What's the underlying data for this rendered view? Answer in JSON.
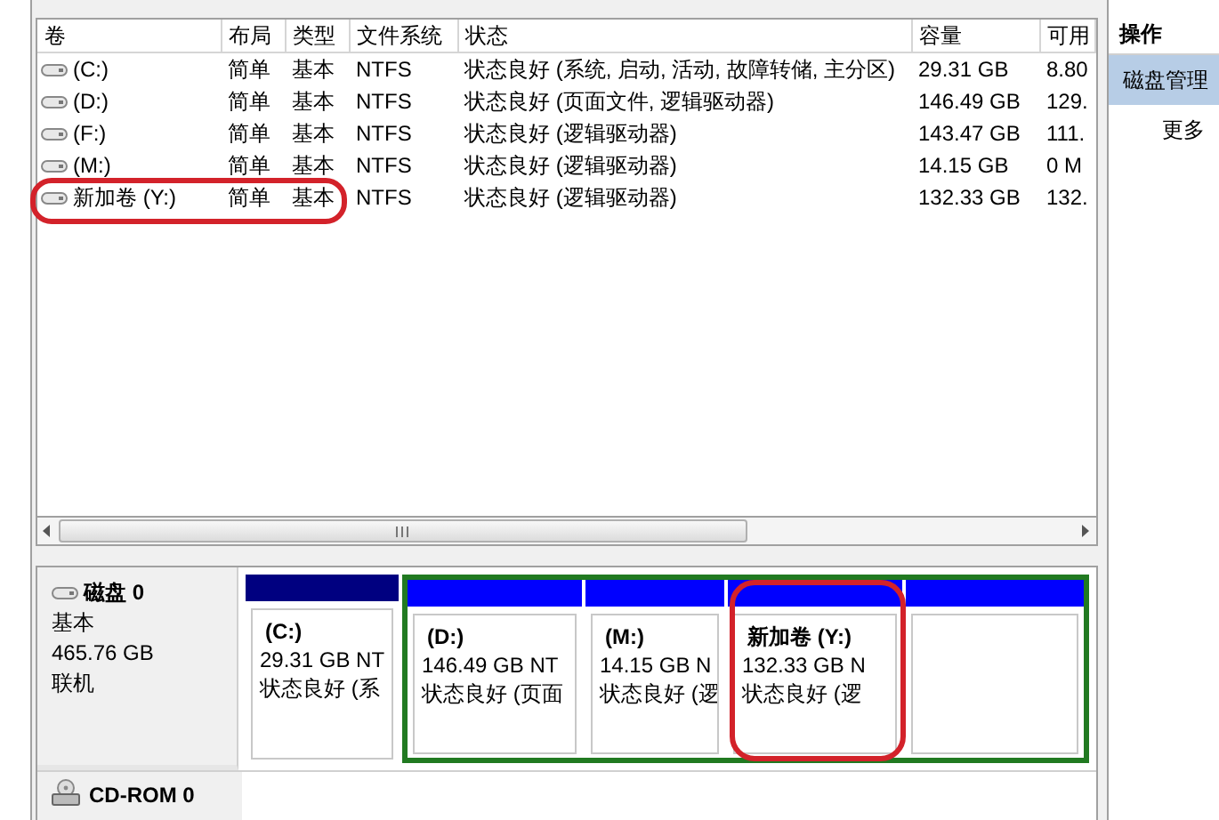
{
  "columns": [
    "卷",
    "布局",
    "类型",
    "文件系统",
    "状态",
    "容量",
    "可用"
  ],
  "volumes": [
    {
      "name": "(C:)",
      "layout": "简单",
      "type": "基本",
      "fs": "NTFS",
      "status": "状态良好 (系统, 启动, 活动, 故障转储, 主分区)",
      "capacity": "29.31 GB",
      "free": "8.80",
      "highlighted": false
    },
    {
      "name": "(D:)",
      "layout": "简单",
      "type": "基本",
      "fs": "NTFS",
      "status": "状态良好 (页面文件, 逻辑驱动器)",
      "capacity": "146.49 GB",
      "free": "129.",
      "highlighted": false
    },
    {
      "name": "(F:)",
      "layout": "简单",
      "type": "基本",
      "fs": "NTFS",
      "status": "状态良好 (逻辑驱动器)",
      "capacity": "143.47 GB",
      "free": "111.",
      "highlighted": false
    },
    {
      "name": "(M:)",
      "layout": "简单",
      "type": "基本",
      "fs": "NTFS",
      "status": "状态良好 (逻辑驱动器)",
      "capacity": "14.15 GB",
      "free": "0 M",
      "highlighted": false
    },
    {
      "name": "新加卷 (Y:)",
      "layout": "简单",
      "type": "基本",
      "fs": "NTFS",
      "status": "状态良好 (逻辑驱动器)",
      "capacity": "132.33 GB",
      "free": "132.",
      "highlighted": true
    }
  ],
  "disks": [
    {
      "kind": "disk",
      "name": "磁盘 0",
      "type": "基本",
      "size": "465.76 GB",
      "state": "联机",
      "partitions": [
        {
          "label": "(C:)",
          "size": "29.31 GB NT",
          "status": "状态良好 (系",
          "color": "#000080",
          "extended": false,
          "highlighted": false
        },
        {
          "label": "(D:)",
          "size": "146.49 GB NT",
          "status": "状态良好 (页面",
          "color": "#0000ff",
          "extended": true,
          "highlighted": false
        },
        {
          "label": "(M:)",
          "size": "14.15 GB N",
          "status": "状态良好 (逻",
          "color": "#0000ff",
          "extended": true,
          "highlighted": false
        },
        {
          "label": "新加卷  (Y:)",
          "size": "132.33 GB N",
          "status": "状态良好 (逻",
          "color": "#0000ff",
          "extended": true,
          "highlighted": true
        },
        {
          "color": "#0000ff",
          "extended": true,
          "highlighted": false
        }
      ]
    },
    {
      "kind": "cdrom",
      "name": "CD-ROM 0"
    }
  ],
  "actions": {
    "title": "操作",
    "items": [
      {
        "label": "磁盘管理",
        "selected": true
      },
      {
        "label": "更多",
        "selected": false
      }
    ]
  }
}
